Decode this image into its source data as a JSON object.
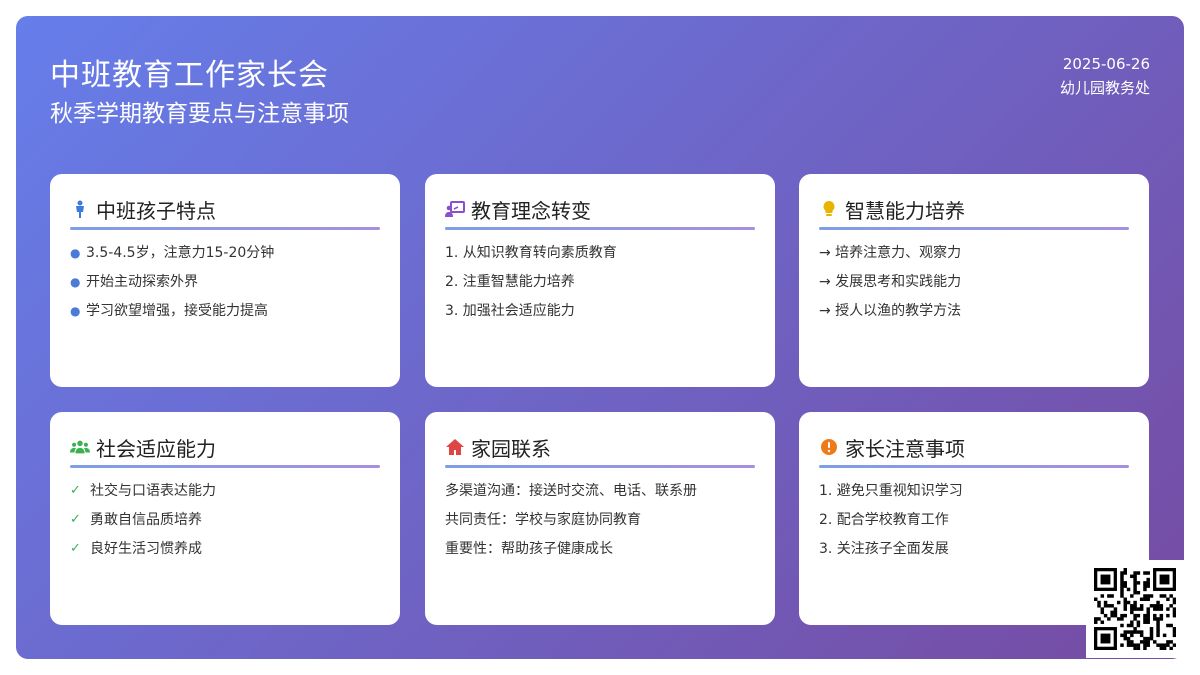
{
  "header": {
    "title": "中班教育工作家长会",
    "subtitle": "秋季学期教育要点与注意事项",
    "date": "2025-06-26",
    "org": "幼儿园教务处"
  },
  "cards": [
    {
      "title": "中班孩子特点",
      "icon": "child-icon",
      "items": [
        "3.5-4.5岁，注意力15-20分钟",
        "开始主动探索外界",
        "学习欲望增强，接受能力提高"
      ]
    },
    {
      "title": "教育理念转变",
      "icon": "teacher-board-icon",
      "items": [
        "1. 从知识教育转向素质教育",
        "2. 注重智慧能力培养",
        "3. 加强社会适应能力"
      ]
    },
    {
      "title": "智慧能力培养",
      "icon": "lightbulb-icon",
      "items": [
        "→ 培养注意力、观察力",
        "→ 发展思考和实践能力",
        "→ 授人以渔的教学方法"
      ]
    },
    {
      "title": "社会适应能力",
      "icon": "users-icon",
      "items": [
        "社交与口语表达能力",
        "勇敢自信品质培养",
        "良好生活习惯养成"
      ]
    },
    {
      "title": "家园联系",
      "icon": "home-icon",
      "items": [
        "多渠道沟通：接送时交流、电话、联系册",
        "共同责任：学校与家庭协同教育",
        "重要性：帮助孩子健康成长"
      ]
    },
    {
      "title": "家长注意事项",
      "icon": "alert-icon",
      "items": [
        "1. 避免只重视知识学习",
        "2. 配合学校教育工作",
        "3. 关注孩子全面发展"
      ]
    }
  ],
  "colors": {
    "gradient_start": "#667eea",
    "gradient_end": "#764ba2",
    "check": "#3bb04f",
    "dot": "#4a7bd8"
  }
}
